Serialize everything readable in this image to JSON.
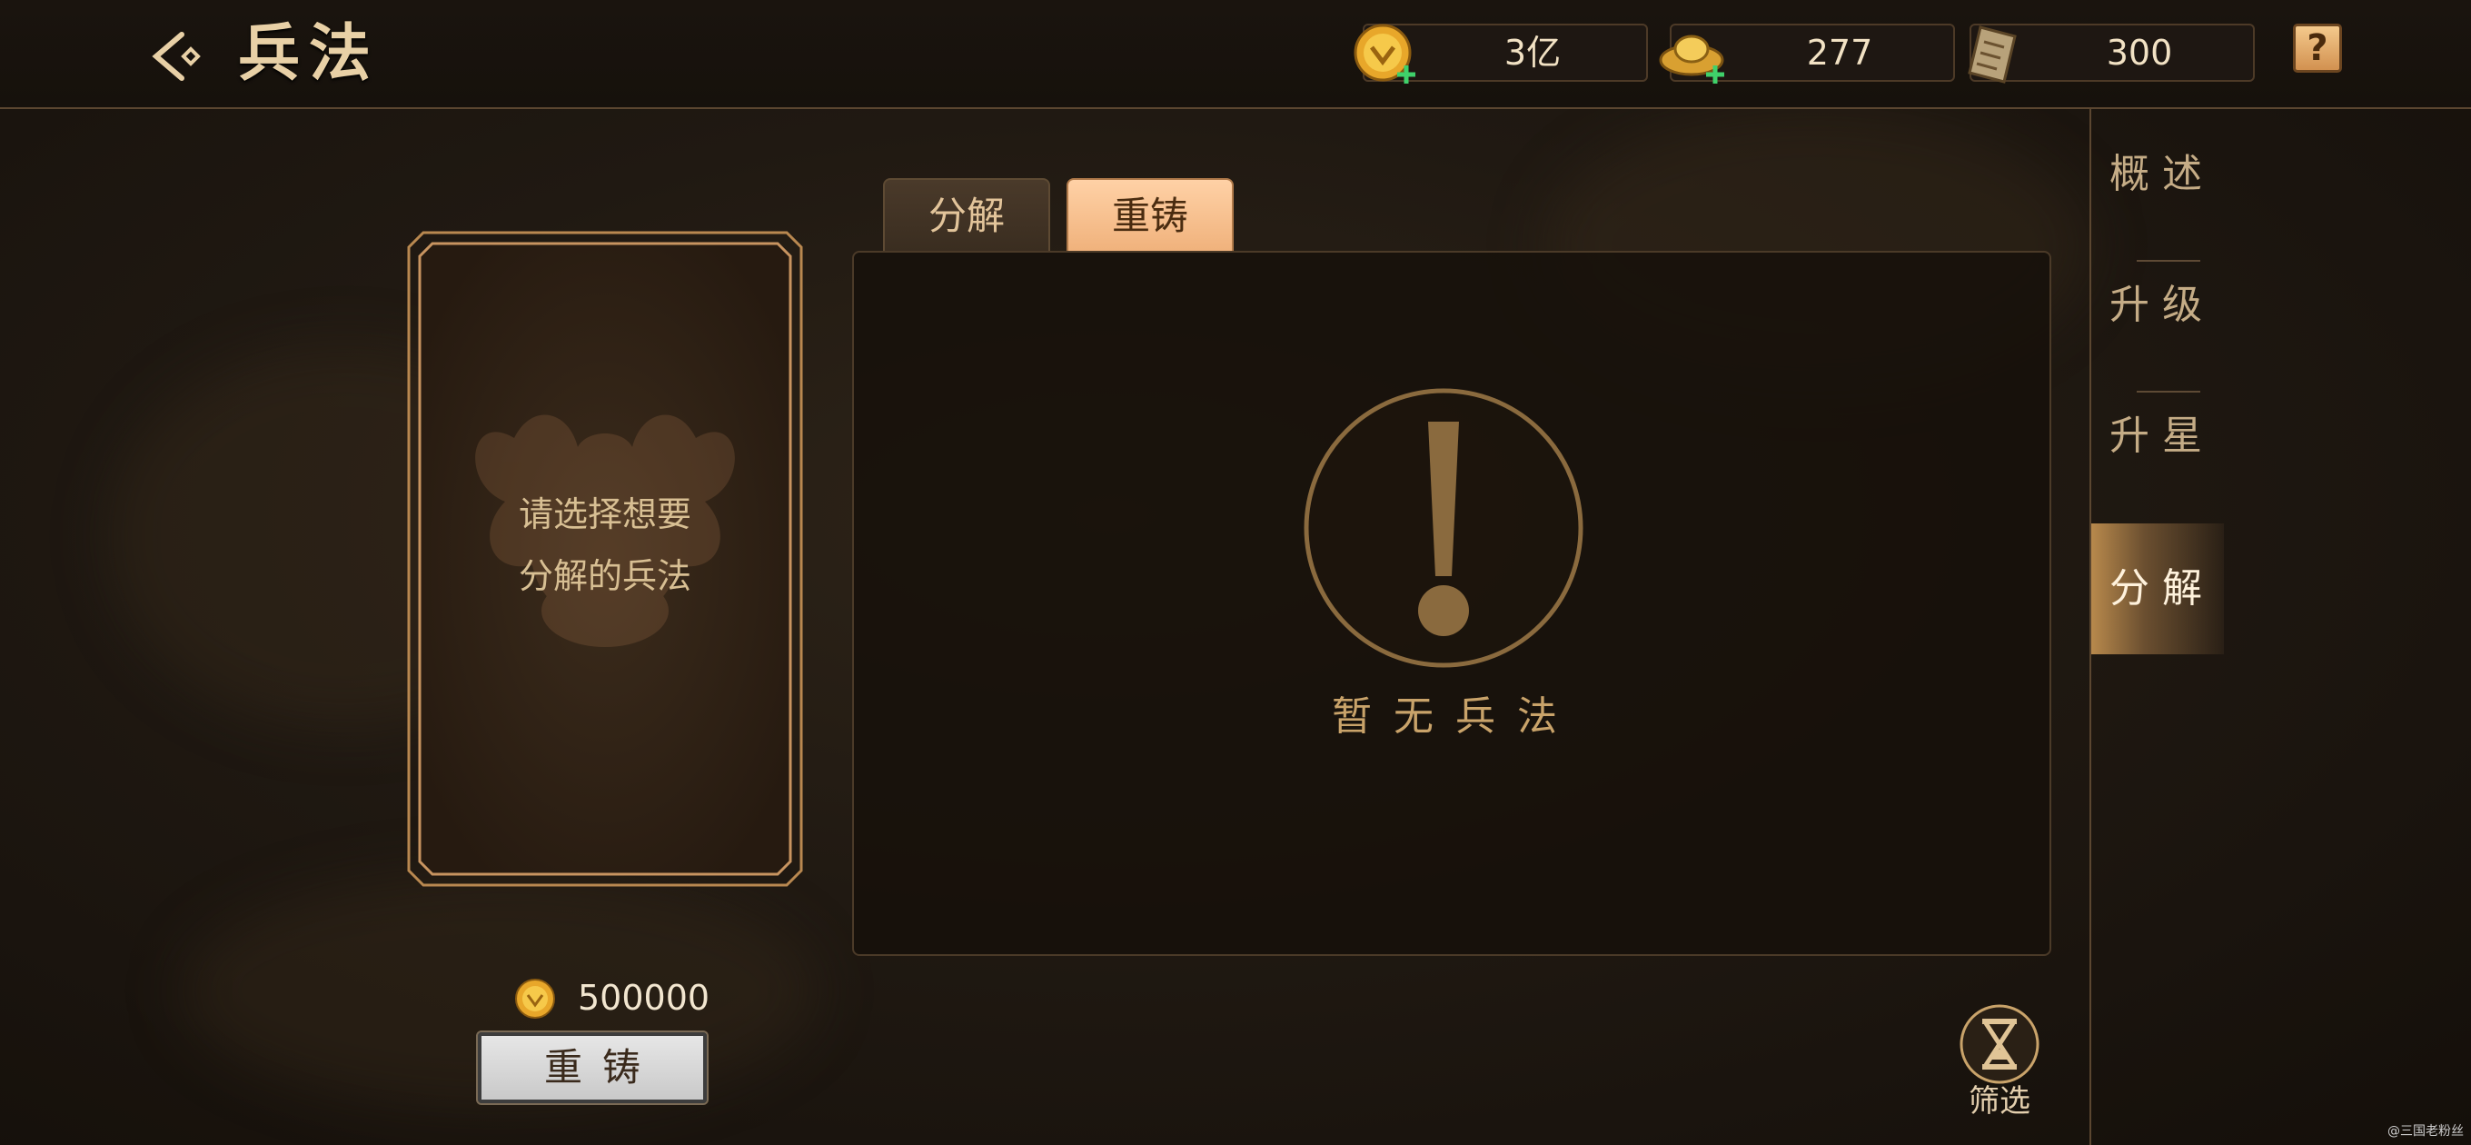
{
  "header": {
    "title": "兵法",
    "currencies": [
      {
        "icon": "gold-coin-icon",
        "value": "3亿"
      },
      {
        "icon": "gold-ingot-icon",
        "value": "277"
      },
      {
        "icon": "scroll-icon",
        "value": "300"
      }
    ],
    "help_label": "?"
  },
  "card": {
    "prompt_line1": "请选择想要",
    "prompt_line2": "分解的兵法"
  },
  "cost": {
    "icon": "gold-coin-icon",
    "amount": "500000"
  },
  "recast_button_label": "重铸",
  "tabs": [
    {
      "label": "分解",
      "active": false
    },
    {
      "label": "重铸",
      "active": true
    }
  ],
  "empty_state": {
    "text": "暂无兵法"
  },
  "filter": {
    "label": "筛选"
  },
  "sidenav": {
    "items": [
      {
        "label": "概述",
        "active": false
      },
      {
        "label": "升级",
        "active": false
      },
      {
        "label": "升星",
        "active": false
      },
      {
        "label": "分解",
        "active": true
      }
    ]
  },
  "watermark": "@三国老粉丝",
  "colors": {
    "accent": "#f0b27c",
    "gold_text": "#d9b98a",
    "background": "#1b150f"
  }
}
